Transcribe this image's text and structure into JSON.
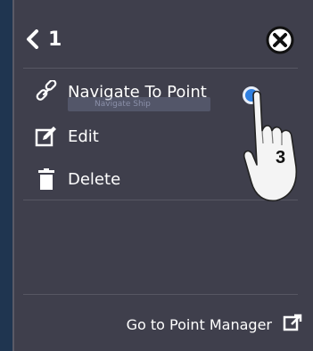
{
  "header": {
    "title": "1",
    "back_icon": "chevron-left-icon",
    "close_icon": "close-circle-icon"
  },
  "menu": {
    "items": [
      {
        "label": "Navigate To Point",
        "icon": "navigate-link-icon"
      },
      {
        "label": "Edit",
        "icon": "edit-icon"
      },
      {
        "label": "Delete",
        "icon": "trash-icon"
      }
    ]
  },
  "ghost_tooltip": "Navigate Ship",
  "annotation": {
    "step": "3"
  },
  "footer": {
    "label": "Go to Point Manager",
    "icon": "open-external-icon"
  },
  "colors": {
    "panel_bg": "#3f3f4c",
    "accent": "#2f7fe0",
    "text": "#ffffff"
  }
}
